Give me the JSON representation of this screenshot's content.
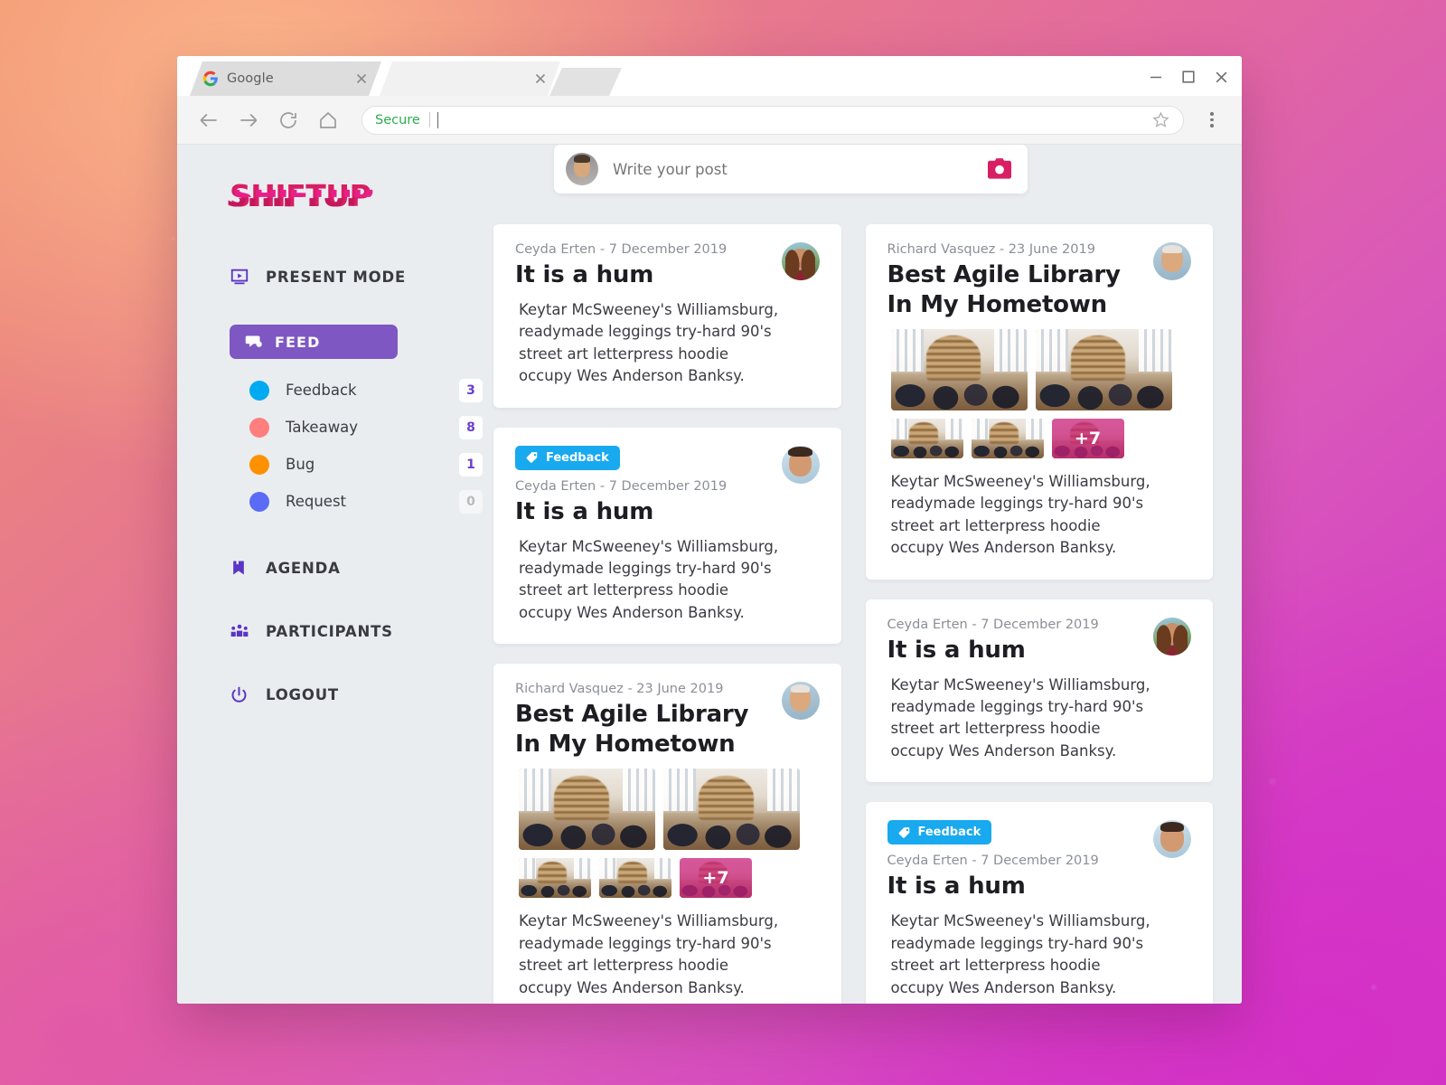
{
  "browser": {
    "tabs": [
      {
        "title": "Google",
        "favicon": "google-icon",
        "active": true
      },
      {
        "title": "",
        "favicon": "none",
        "active": false
      },
      {
        "title": "",
        "favicon": "none",
        "active": false
      }
    ],
    "window_controls": {
      "minimize": "minimize-icon",
      "maximize": "maximize-icon",
      "close": "close-icon"
    },
    "toolbar": {
      "back": "back-arrow-icon",
      "forward": "forward-arrow-icon",
      "reload": "reload-icon",
      "home": "home-icon",
      "secure_label": "Secure",
      "address_value": "",
      "address_placeholder": "",
      "bookmark": "star-icon",
      "menu": "kebab-menu-icon"
    }
  },
  "sidebar": {
    "logo": "SHIFTUP",
    "present_mode": {
      "label": "PRESENT MODE",
      "icon": "presentation-screen-icon"
    },
    "feed": {
      "label": "FEED",
      "icon": "chat-bubble-icon",
      "active": true
    },
    "filters": [
      {
        "label": "Feedback",
        "count": "3",
        "color": "#00AAF0"
      },
      {
        "label": "Takeaway",
        "count": "8",
        "color": "#FF7E7E"
      },
      {
        "label": "Bug",
        "count": "1",
        "color": "#FF9100"
      },
      {
        "label": "Request",
        "count": "0",
        "color": "#5B6BF5"
      }
    ],
    "agenda": {
      "label": "AGENDA",
      "icon": "bookmark-icon"
    },
    "participants": {
      "label": "PARTICIPANTS",
      "icon": "people-group-icon"
    },
    "logout": {
      "label": "LOGOUT",
      "icon": "power-icon"
    }
  },
  "composer": {
    "placeholder": "Write your post",
    "avatar": "user-avatar",
    "camera_icon": "camera-icon",
    "camera_color": "#D81F63"
  },
  "theme": {
    "accent_pink": "#D81F63",
    "accent_purple": "#7E57C2",
    "tag_blue": "#18A9EF",
    "app_background": "#EAEDF0",
    "card_background": "#FFFFFF"
  },
  "posts": {
    "left": [
      {
        "tag": null,
        "meta": "Ceyda Erten - 7 December 2019",
        "title": "It is a hum",
        "body": "Keytar McSweeney's Williamsburg, readymade leggings try-hard 90's street art letterpress hoodie occupy Wes Anderson Banksy.",
        "avatar": "female-avatar",
        "gallery": null
      },
      {
        "tag": "Feedback",
        "meta": "Ceyda Erten - 7 December 2019",
        "title": "It is a hum",
        "body": "Keytar McSweeney's Williamsburg, readymade leggings try-hard 90's street art letterpress hoodie occupy Wes Anderson Banksy.",
        "avatar": "male-avatar-dark",
        "gallery": null
      },
      {
        "tag": null,
        "meta": "Richard Vasquez - 23 June 2019",
        "title": "Best Agile Library In My Hometown",
        "body": "Keytar McSweeney's Williamsburg, readymade leggings try-hard 90's street art letterpress hoodie occupy Wes Anderson Banksy.",
        "avatar": "male-avatar-bald",
        "gallery": {
          "thumbs": 4,
          "more_label": "+7"
        }
      }
    ],
    "right": [
      {
        "tag": null,
        "meta": "Richard Vasquez - 23 June 2019",
        "title": "Best Agile Library In My Hometown",
        "body": "Keytar McSweeney's Williamsburg, readymade leggings try-hard 90's street art letterpress hoodie occupy Wes Anderson Banksy.",
        "avatar": "male-avatar-bald",
        "gallery": {
          "thumbs": 4,
          "more_label": "+7"
        }
      },
      {
        "tag": null,
        "meta": "Ceyda Erten - 7 December 2019",
        "title": "It is a hum",
        "body": "Keytar McSweeney's Williamsburg, readymade leggings try-hard 90's street art letterpress hoodie occupy Wes Anderson Banksy.",
        "avatar": "female-avatar",
        "gallery": null
      },
      {
        "tag": "Feedback",
        "meta": "Ceyda Erten - 7 December 2019",
        "title": "It is a hum",
        "body": "Keytar McSweeney's Williamsburg, readymade leggings try-hard 90's street art letterpress hoodie occupy Wes Anderson Banksy.",
        "avatar": "male-avatar-dark",
        "gallery": null
      }
    ]
  }
}
